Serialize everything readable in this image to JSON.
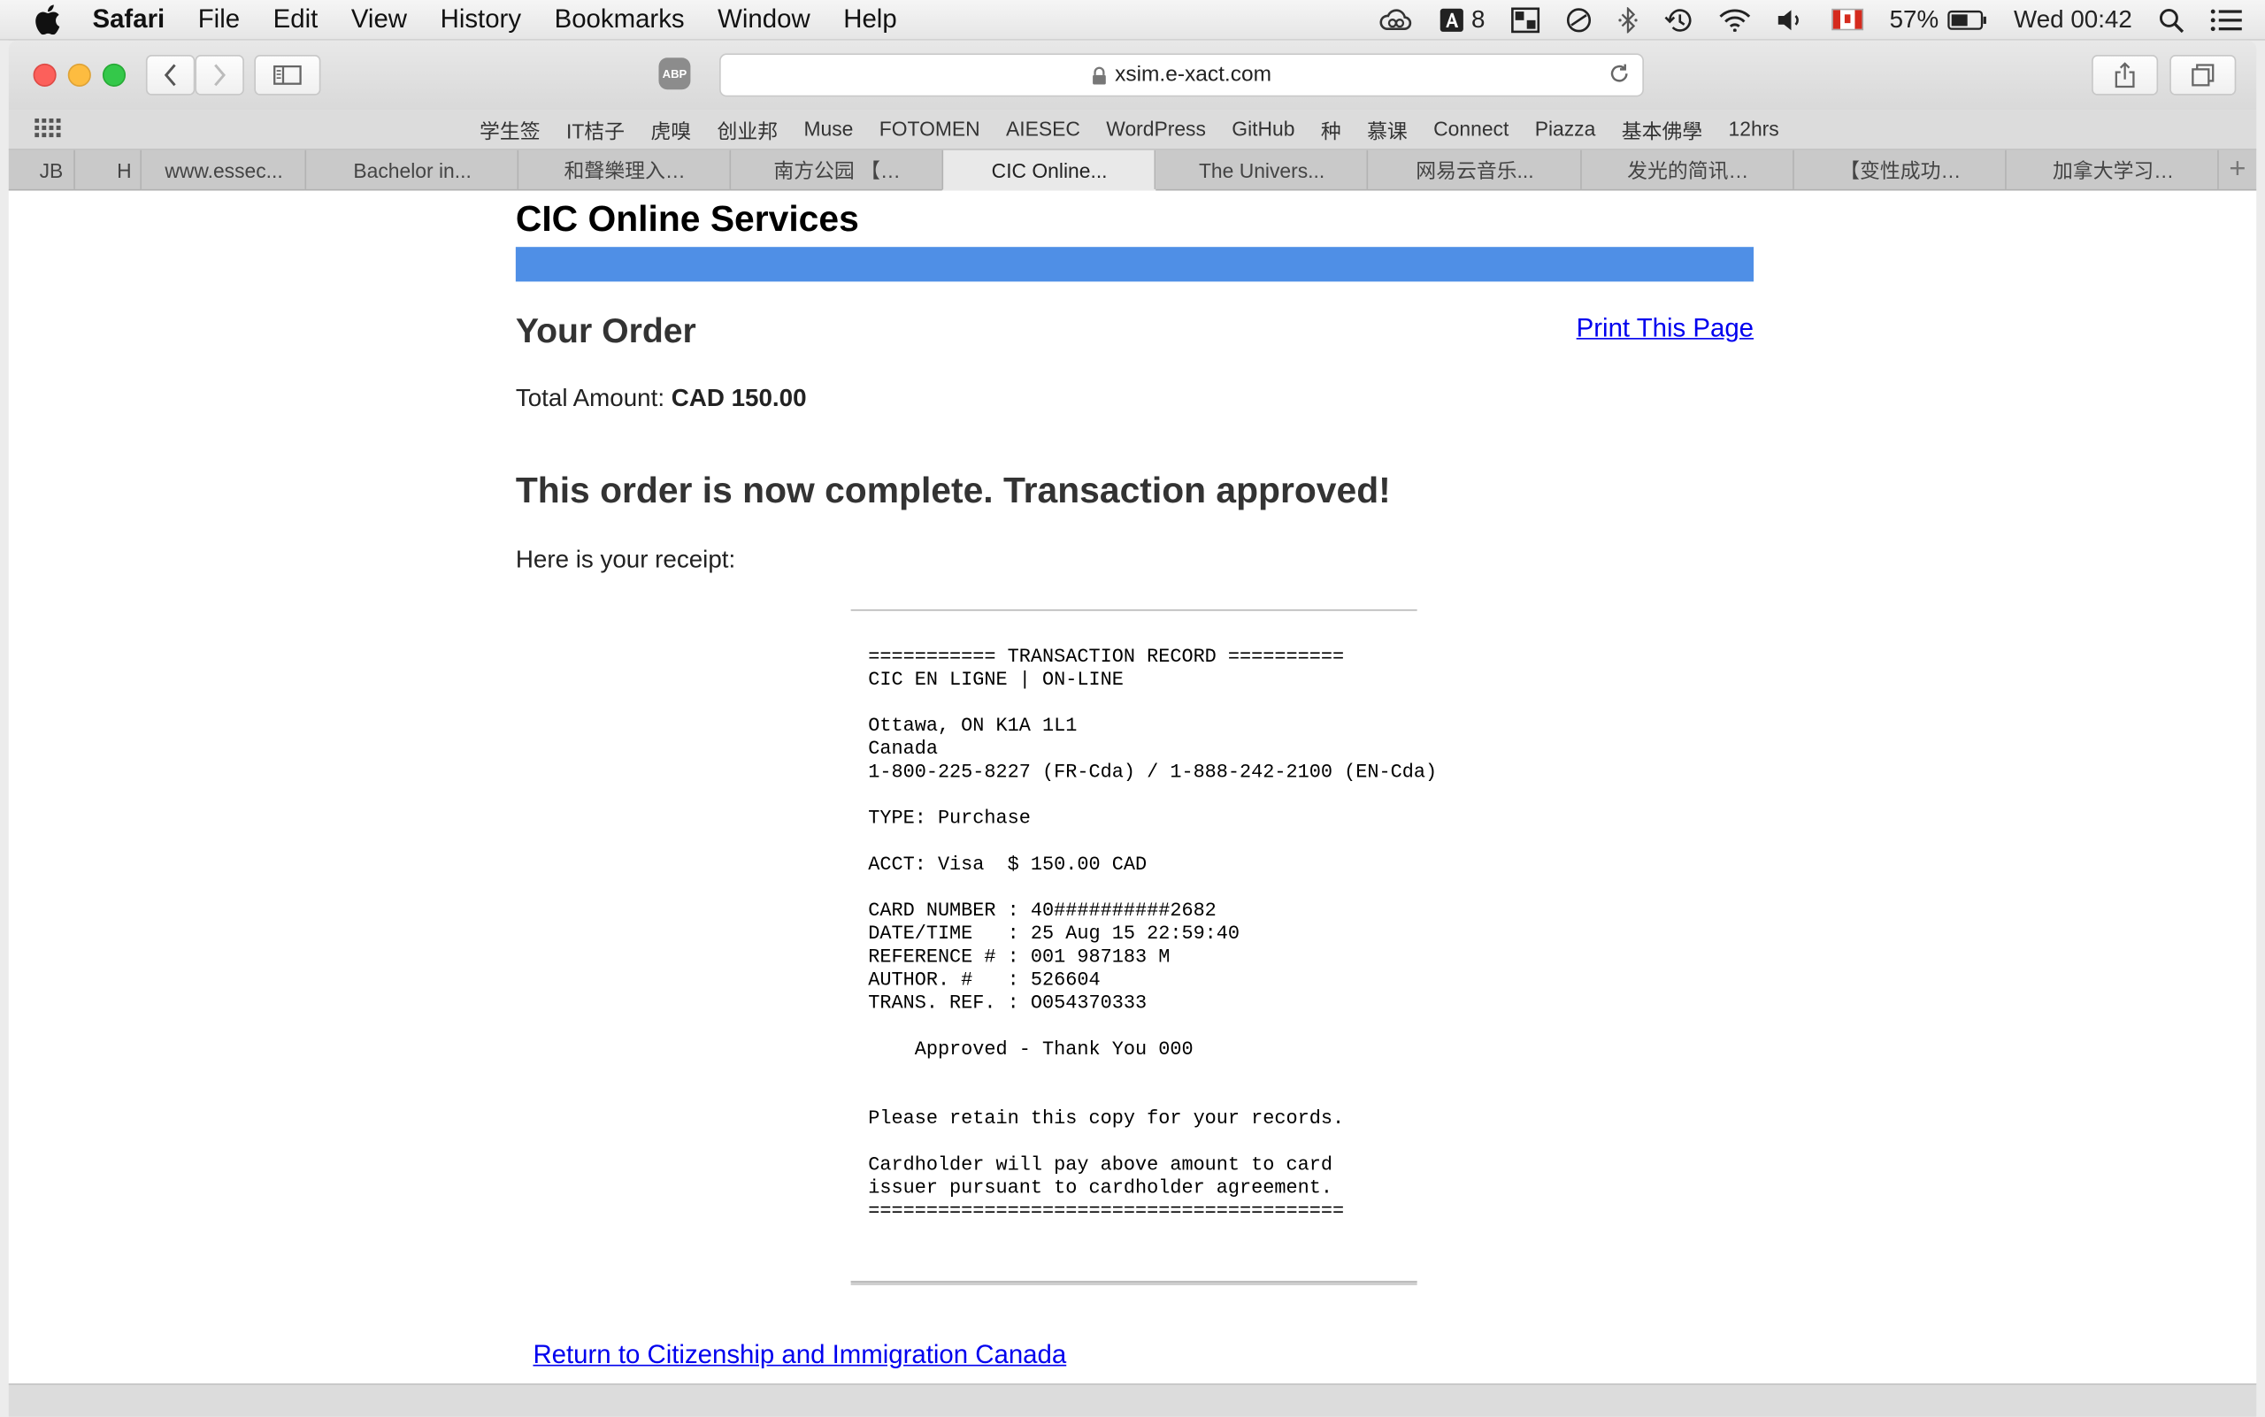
{
  "menubar": {
    "app": "Safari",
    "menus": [
      "File",
      "Edit",
      "View",
      "History",
      "Bookmarks",
      "Window",
      "Help"
    ],
    "status": {
      "adobe_badge": "8",
      "battery": "57%",
      "clock": "Wed 00:42"
    }
  },
  "toolbar": {
    "adblock_label": "ABP",
    "url": "xsim.e-xact.com"
  },
  "favorites": [
    "学生签",
    "IT桔子",
    "虎嗅",
    "创业邦",
    "Muse",
    "FOTOMEN",
    "AIESEC",
    "WordPress",
    "GitHub",
    "种",
    "慕课",
    "Connect",
    "Piazza",
    "基本佛學",
    "12hrs"
  ],
  "tabs": [
    "JB",
    "H",
    "www.essec...",
    "Bachelor in...",
    "和聲樂理入…",
    "南方公园 【…",
    "CIC Online...",
    "The Univers...",
    "网易云音乐...",
    "发光的简讯…",
    "【变性成功…",
    "加拿大学习…"
  ],
  "page": {
    "site_title": "CIC Online Services",
    "order_heading": "Your Order",
    "print_link": "Print This Page",
    "total_label": "Total Amount:",
    "total_value": "CAD 150.00",
    "complete_heading": "This order is now complete. Transaction approved!",
    "receipt_intro": "Here is your receipt:",
    "receipt_lines": [
      "=========== TRANSACTION RECORD ==========",
      "CIC EN LIGNE | ON-LINE",
      "",
      "Ottawa, ON K1A 1L1",
      "Canada",
      "1-800-225-8227 (FR-Cda) / 1-888-242-2100 (EN-Cda)",
      "",
      "TYPE: Purchase",
      "",
      "ACCT: Visa  $ 150.00 CAD",
      "",
      "CARD NUMBER : 40##########2682",
      "DATE/TIME   : 25 Aug 15 22:59:40",
      "REFERENCE # : 001 987183 M",
      "AUTHOR. #   : 526604",
      "TRANS. REF. : O054370333",
      "",
      "    Approved - Thank You 000",
      "",
      "",
      "Please retain this copy for your records.",
      "",
      "Cardholder will pay above amount to card",
      "issuer pursuant to cardholder agreement.",
      "========================================="
    ],
    "return_link": "Return to Citizenship and Immigration Canada"
  },
  "colors": {
    "brand_bar": "#4f8fe6",
    "link": "#0000ee",
    "traffic_close": "#fc605b",
    "traffic_min": "#fdbc40",
    "traffic_max": "#34c84a"
  }
}
